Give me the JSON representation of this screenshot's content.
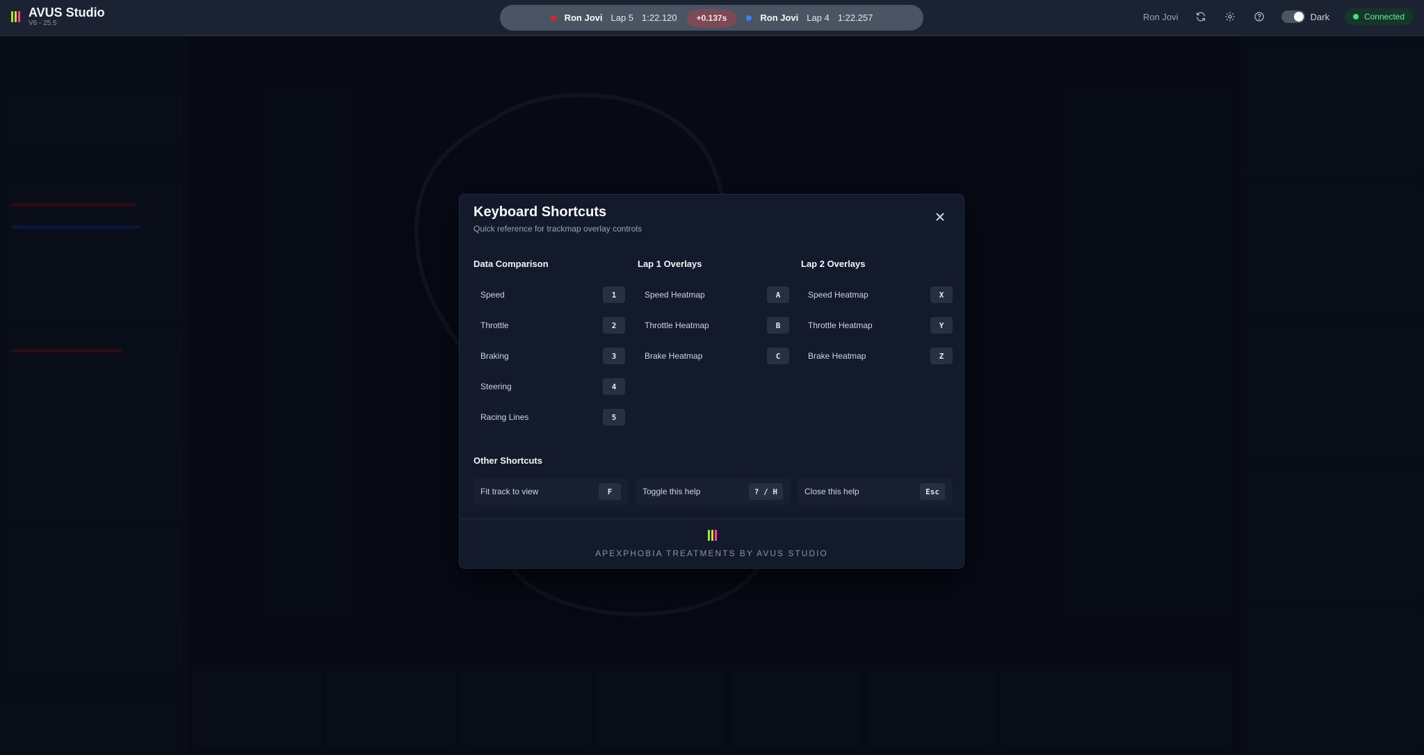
{
  "app": {
    "title": "AVUS Studio",
    "version": "V6 - 25.5",
    "logo_colors": [
      "#a3e635",
      "#facc15",
      "#ec4899"
    ]
  },
  "lap_compare": {
    "lap1": {
      "driver": "Ron Jovi",
      "lap": "Lap 5",
      "time": "1:22.120",
      "color": "#dc2626"
    },
    "delta": "+0.137s",
    "lap2": {
      "driver": "Ron Jovi",
      "lap": "Lap 4",
      "time": "1:22.257",
      "color": "#3b82f6"
    }
  },
  "header_right": {
    "user": "Ron Jovi",
    "theme_label": "Dark",
    "status": "Connected"
  },
  "icons": [
    "refresh-icon",
    "gear-icon",
    "help-icon",
    "close-icon"
  ],
  "modal": {
    "title": "Keyboard Shortcuts",
    "subtitle": "Quick reference for trackmap overlay controls",
    "sections": [
      {
        "title": "Data Comparison",
        "items": [
          {
            "label": "Speed",
            "key": "1"
          },
          {
            "label": "Throttle",
            "key": "2"
          },
          {
            "label": "Braking",
            "key": "3"
          },
          {
            "label": "Steering",
            "key": "4"
          },
          {
            "label": "Racing Lines",
            "key": "5"
          }
        ]
      },
      {
        "title": "Lap 1 Overlays",
        "items": [
          {
            "label": "Speed Heatmap",
            "key": "A"
          },
          {
            "label": "Throttle Heatmap",
            "key": "B"
          },
          {
            "label": "Brake Heatmap",
            "key": "C"
          }
        ]
      },
      {
        "title": "Lap 2 Overlays",
        "items": [
          {
            "label": "Speed Heatmap",
            "key": "X"
          },
          {
            "label": "Throttle Heatmap",
            "key": "Y"
          },
          {
            "label": "Brake Heatmap",
            "key": "Z"
          }
        ]
      }
    ],
    "other": {
      "title": "Other Shortcuts",
      "items": [
        {
          "label": "Fit track to view",
          "key": "F"
        },
        {
          "label": "Toggle this help",
          "key": "? / H"
        },
        {
          "label": "Close this help",
          "key": "Esc"
        }
      ]
    },
    "footer": "APEXPHOBIA TREATMENTS BY AVUS STUDIO"
  }
}
